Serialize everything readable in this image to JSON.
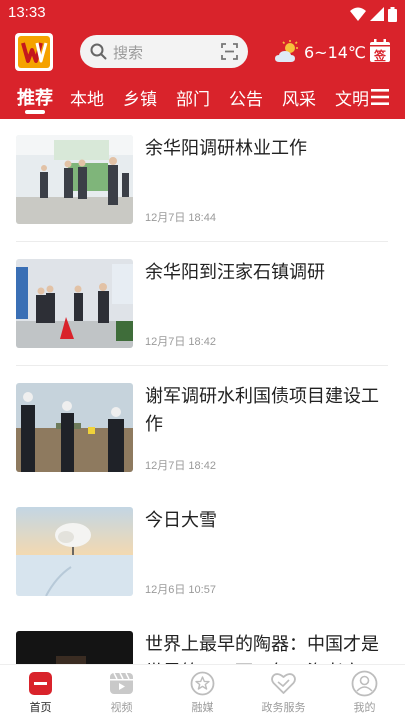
{
  "status_bar": {
    "time": "13:33"
  },
  "header": {
    "search": {
      "placeholder": "搜索"
    },
    "weather": {
      "text": "6~14℃"
    },
    "signin": {
      "label": "签"
    }
  },
  "tabs": [
    {
      "label": "推荐",
      "active": true
    },
    {
      "label": "本地",
      "active": false
    },
    {
      "label": "乡镇",
      "active": false
    },
    {
      "label": "部门",
      "active": false
    },
    {
      "label": "公告",
      "active": false
    },
    {
      "label": "风采",
      "active": false
    },
    {
      "label": "文明",
      "active": false
    }
  ],
  "news": [
    {
      "title": "余华阳调研林业工作",
      "date": "12月7日 18:44"
    },
    {
      "title": "余华阳到汪家石镇调研",
      "date": "12月7日 18:42"
    },
    {
      "title": "谢军调研水利国债项目建设工作",
      "date": "12月7日 18:42"
    },
    {
      "title": "今日大雪",
      "date": "12月6日 10:57"
    },
    {
      "title": "世界上最早的陶器：中国才是世界第一，两万年，海老高",
      "date": ""
    }
  ],
  "bottom_nav": [
    {
      "label": "首页",
      "icon": "home-icon",
      "active": true
    },
    {
      "label": "视频",
      "icon": "video-icon",
      "active": false
    },
    {
      "label": "融媒",
      "icon": "star-icon",
      "active": false
    },
    {
      "label": "政务服务",
      "icon": "heart-hands-icon",
      "active": false
    },
    {
      "label": "我的",
      "icon": "user-icon",
      "active": false
    }
  ],
  "colors": {
    "brand_red": "#d9232b",
    "logo_orange": "#f5a200"
  }
}
